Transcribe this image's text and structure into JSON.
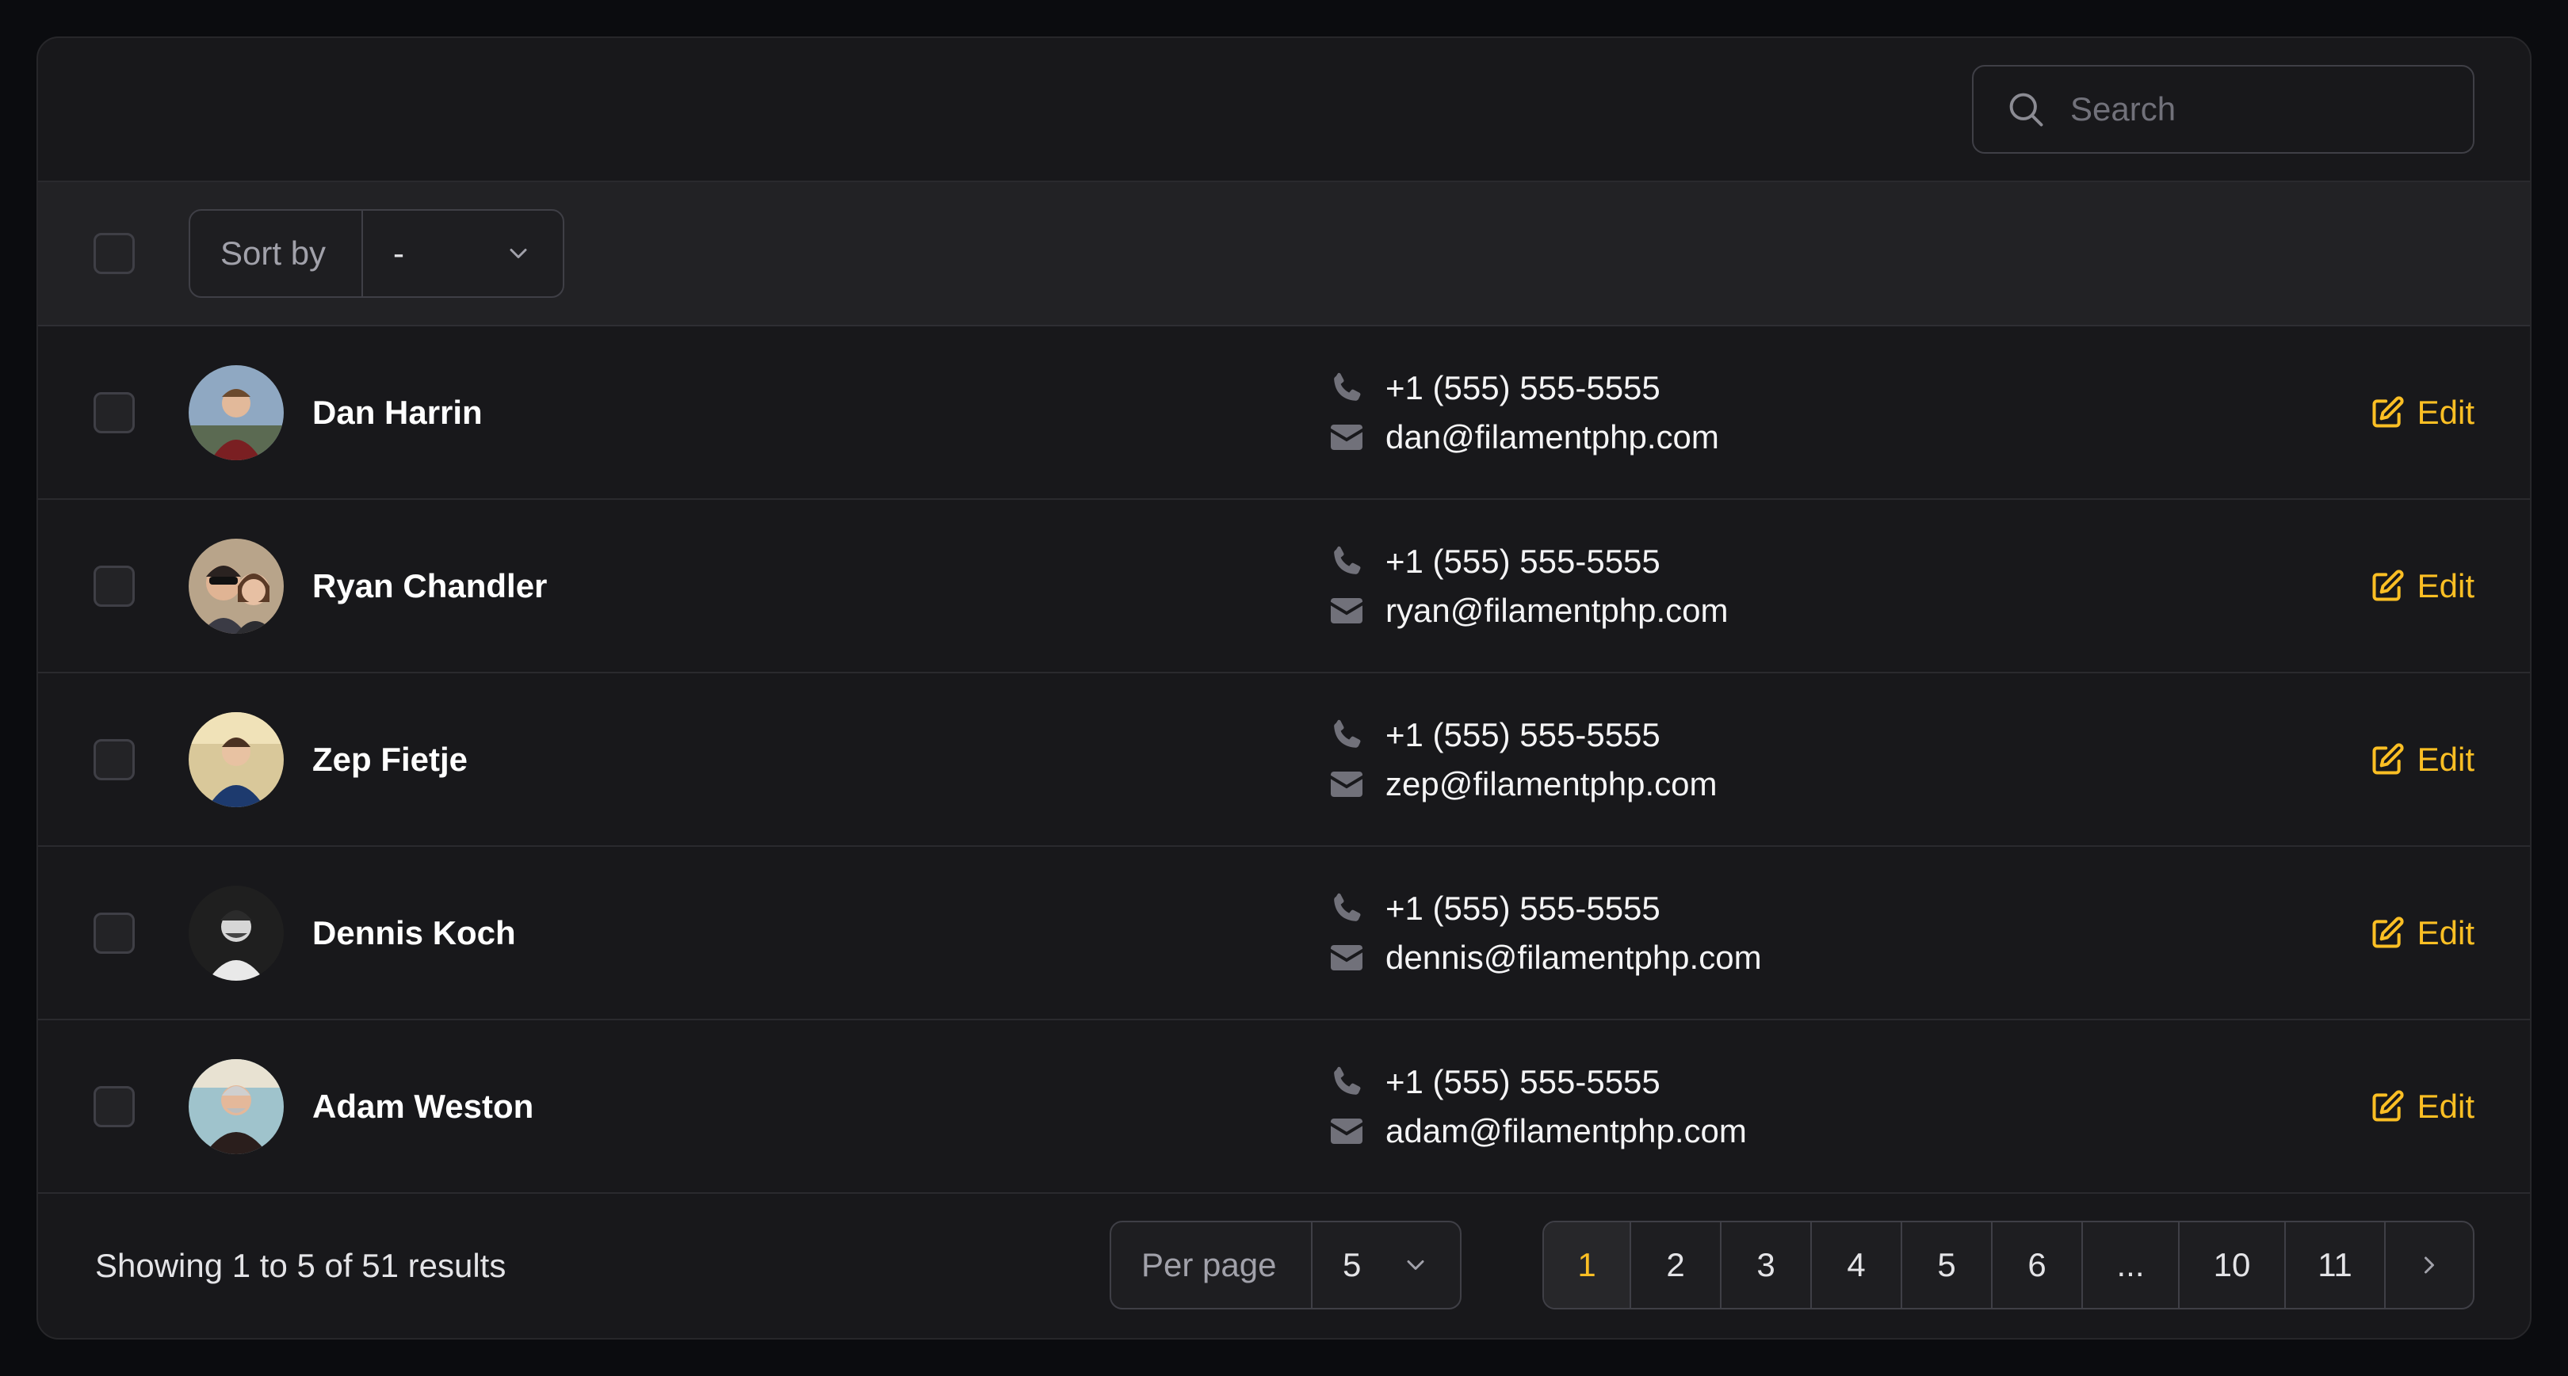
{
  "search": {
    "placeholder": "Search"
  },
  "toolbar": {
    "sort_label": "Sort by",
    "sort_value": "-"
  },
  "rows": [
    {
      "name": "Dan Harrin",
      "phone": "+1 (555) 555-5555",
      "email": "dan@filamentphp.com",
      "action": "Edit"
    },
    {
      "name": "Ryan Chandler",
      "phone": "+1 (555) 555-5555",
      "email": "ryan@filamentphp.com",
      "action": "Edit"
    },
    {
      "name": "Zep Fietje",
      "phone": "+1 (555) 555-5555",
      "email": "zep@filamentphp.com",
      "action": "Edit"
    },
    {
      "name": "Dennis Koch",
      "phone": "+1 (555) 555-5555",
      "email": "dennis@filamentphp.com",
      "action": "Edit"
    },
    {
      "name": "Adam Weston",
      "phone": "+1 (555) 555-5555",
      "email": "adam@filamentphp.com",
      "action": "Edit"
    }
  ],
  "footer": {
    "summary": "Showing 1 to 5 of 51 results",
    "per_page_label": "Per page",
    "per_page_value": "5",
    "pages": [
      "1",
      "2",
      "3",
      "4",
      "5",
      "6",
      "...",
      "10",
      "11"
    ],
    "active_page": "1"
  },
  "colors": {
    "accent": "#fbbf24",
    "background": "#18181b",
    "border": "#3f3f46"
  },
  "icons": {
    "search": "search-icon",
    "phone": "phone-icon",
    "email": "envelope-icon",
    "edit": "pencil-square-icon",
    "next": "chevron-right-icon"
  }
}
